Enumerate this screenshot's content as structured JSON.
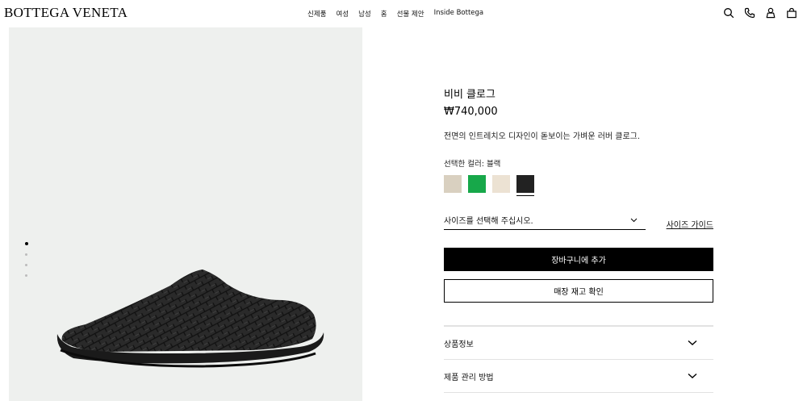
{
  "header": {
    "logo": "BOTTEGA VENETA",
    "nav": [
      "신제품",
      "여성",
      "남성",
      "홈",
      "선물 제안",
      "Inside Bottega"
    ],
    "icons": [
      "search-icon",
      "phone-icon",
      "bag-icon",
      "cart-icon"
    ]
  },
  "gallery": {
    "slides": 4,
    "active_slide": 1,
    "background": "#eef0ee"
  },
  "product": {
    "name": "비비 클로그",
    "price": "₩740,000",
    "description": "전면의 인트레치오 디자인이 돋보이는 가벼운 러버 클로그.",
    "color_label": "선택한 컬러: 블랙",
    "swatches": [
      {
        "name": "beige",
        "color": "#d9d0c0"
      },
      {
        "name": "green",
        "color": "#17a84a"
      },
      {
        "name": "cream",
        "color": "#ece2d3"
      },
      {
        "name": "black",
        "color": "#222222",
        "selected": true
      }
    ],
    "size_placeholder": "사이즈를 선택해 주십시오.",
    "size_guide": "사이즈 가이드",
    "add_to_cart": "장바구니에 추가",
    "check_store": "매장 재고 확인",
    "accordion": [
      "상품정보",
      "제품 관리 방법"
    ]
  }
}
